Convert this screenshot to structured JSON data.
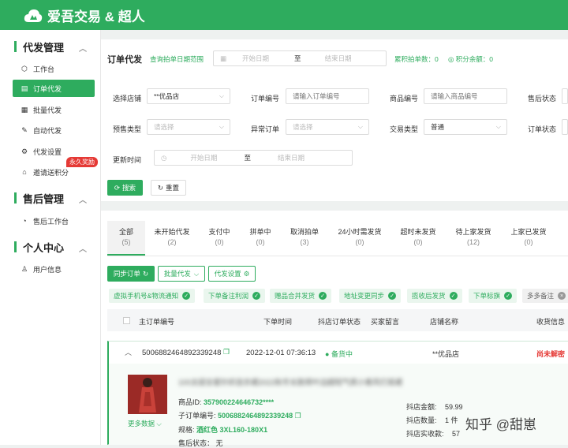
{
  "brand": {
    "name": "爱吾交易 & 超人",
    "color": "#2eac5e"
  },
  "sidebar": {
    "sections": [
      {
        "title": "代发管理",
        "items": [
          {
            "label": "工作台",
            "icon": "cube-icon"
          },
          {
            "label": "订单代发",
            "icon": "order-icon",
            "active": true
          },
          {
            "label": "批量代发",
            "icon": "batch-icon"
          },
          {
            "label": "自动代发",
            "icon": "auto-icon"
          },
          {
            "label": "代发设置",
            "icon": "settings-doc-icon"
          },
          {
            "label": "邀请送积分",
            "icon": "gift-icon",
            "badge": "永久奖励"
          }
        ]
      },
      {
        "title": "售后管理",
        "items": [
          {
            "label": "售后工作台",
            "icon": "aftersale-icon"
          }
        ]
      },
      {
        "title": "个人中心",
        "items": [
          {
            "label": "用户信息",
            "icon": "user-icon"
          }
        ]
      }
    ]
  },
  "header": {
    "title": "订单代发",
    "date_range_label": "查询拍单日期范围",
    "start_placeholder": "开始日期",
    "to": "至",
    "end_placeholder": "结束日期",
    "total_orders": "累积拍单数：0",
    "points_balance": "积分余额：0"
  },
  "filters": {
    "shop_label": "选择店铺",
    "shop_value": "**优品店",
    "order_no_label": "订单编号",
    "order_no_placeholder": "请输入订单编号",
    "goods_no_label": "商品编号",
    "goods_no_placeholder": "请输入商品编号",
    "aftersale_label": "售后状态",
    "presale_label": "预售类型",
    "presale_placeholder": "请选择",
    "abnormal_label": "异常订单",
    "abnormal_placeholder": "请选择",
    "trade_type_label": "交易类型",
    "trade_type_value": "普通",
    "order_status_label": "订单状态",
    "update_time_label": "更新时间",
    "start_placeholder": "开始日期",
    "to": "至",
    "end_placeholder": "结束日期",
    "search_label": "搜索",
    "reset_label": "重置"
  },
  "tabs": [
    {
      "label": "全部",
      "count": "(5)",
      "active": true
    },
    {
      "label": "未开始代发",
      "count": "(2)"
    },
    {
      "label": "支付中",
      "count": "(0)"
    },
    {
      "label": "拼单中",
      "count": "(0)"
    },
    {
      "label": "取消拍单",
      "count": "(3)"
    },
    {
      "label": "24小时需发货",
      "count": "(0)"
    },
    {
      "label": "超时未发货",
      "count": "(0)"
    },
    {
      "label": "待上家发货",
      "count": "(12)"
    },
    {
      "label": "上家已发货",
      "count": "(0)"
    }
  ],
  "actions": {
    "sync": "同步订单",
    "batch": "批量代发",
    "settings": "代发设置"
  },
  "chips": [
    "虚拟手机号&物流通知",
    "下单备注利润",
    "赠品合并发货",
    "地址变更同步",
    "揽收后发货",
    "下单标旗",
    "多多备注"
  ],
  "table": {
    "headers": [
      "主订单编号",
      "下单时间",
      "抖店订单状态",
      "买家留言",
      "店铺名称",
      "收货信息"
    ],
    "order": {
      "id": "5006882464892339248",
      "time": "2022-12-01 07:36:13",
      "status": "备货中",
      "shop": "**优品店",
      "state": "尚未解密",
      "title": "100太妞全套针织连衣裙2022秋冬长款荷叶边超短气质小香风打底裙",
      "goods_id_label": "商品ID:",
      "goods_id": "357900224646732****",
      "sub_order_label": "子订单编号:",
      "sub_order": "5006882464892339248",
      "spec_label": "规格:",
      "spec": "酒红色 3XL160-180X1",
      "aftersale_label": "售后状态：",
      "aftersale": "无",
      "more": "更多数据",
      "amount_label": "抖店金额:",
      "amount": "59.99",
      "qty_label": "抖店数量:",
      "qty": "1 件",
      "paid_label": "抖店实收款:",
      "paid": "57"
    }
  },
  "watermark": "知乎 @甜崽"
}
